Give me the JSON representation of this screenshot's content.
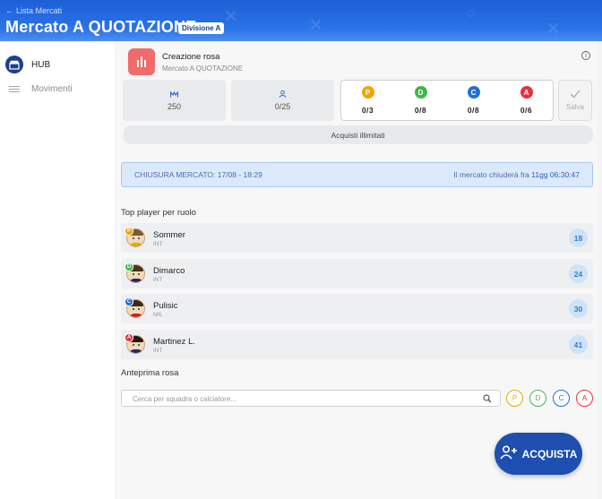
{
  "header": {
    "back_label": "Lista Mercati",
    "title": "Mercato A QUOTAZIONE",
    "division_badge": "Divisione A"
  },
  "sidebar": {
    "items": [
      {
        "label": "HUB",
        "icon": "store-icon",
        "active": true
      },
      {
        "label": "Movimenti",
        "icon": "list-icon",
        "active": false
      }
    ]
  },
  "creation": {
    "title": "Creazione rosa",
    "subtitle": "Mercato A QUOTAZIONE",
    "budget_value": "250",
    "roster_value": "0/25",
    "roles": [
      {
        "letter": "P",
        "count": "0/3",
        "color": "#f0a500"
      },
      {
        "letter": "D",
        "count": "0/8",
        "color": "#3fb84a"
      },
      {
        "letter": "C",
        "count": "0/8",
        "color": "#1f6fd6"
      },
      {
        "letter": "A",
        "count": "0/6",
        "color": "#e5323c"
      }
    ],
    "save_label": "Salva",
    "unlimited_label": "Acquisti illimitati"
  },
  "closing": {
    "label": "CHIUSURA MERCATO: 17/08 - 18:29",
    "countdown_prefix": "Il mercato chiuderà fra ",
    "countdown_value": "11gg 06:30:47"
  },
  "top_players": {
    "title": "Top player per ruolo",
    "items": [
      {
        "name": "Sommer",
        "team": "INT",
        "role": "P",
        "value": "18"
      },
      {
        "name": "Dimarco",
        "team": "INT",
        "role": "D",
        "value": "24"
      },
      {
        "name": "Pulisic",
        "team": "MIL",
        "role": "C",
        "value": "30"
      },
      {
        "name": "Martinez L.",
        "team": "INT",
        "role": "A",
        "value": "41"
      }
    ]
  },
  "preview": {
    "title": "Anteprima rosa",
    "search_placeholder": "Cerca per squadra o calciatore...",
    "filters": [
      "P",
      "D",
      "C",
      "A"
    ]
  },
  "fab": {
    "label": "ACQUISTA"
  },
  "colors": {
    "primary": "#1e4fb0",
    "header": "#2a73e8",
    "accent_red": "#f06b6b"
  }
}
